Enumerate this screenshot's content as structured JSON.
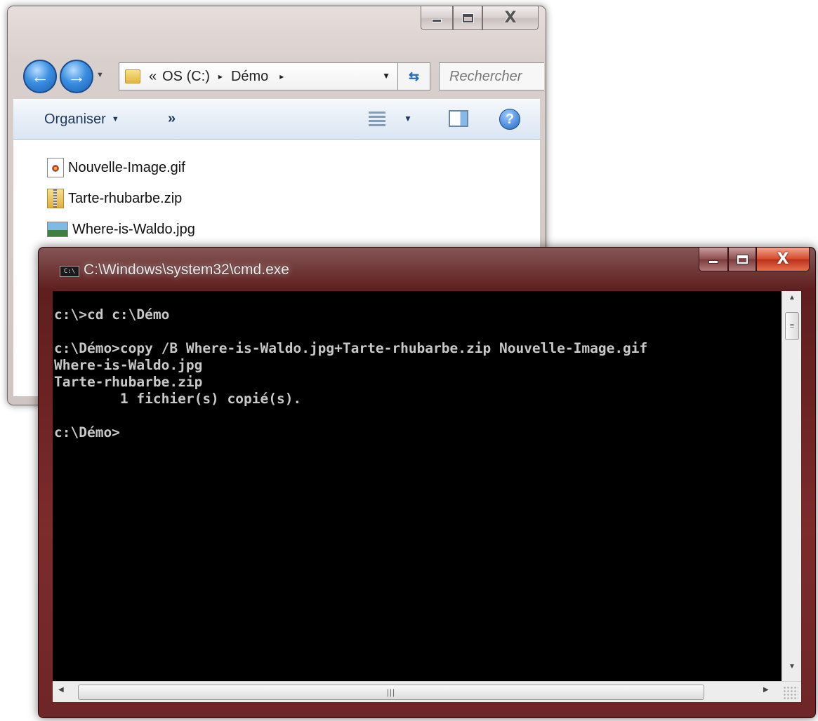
{
  "explorer": {
    "caption": {
      "minimize": "minimize",
      "maximize": "maximize",
      "close": "X"
    },
    "nav": {
      "back_icon": "back-arrow-icon",
      "forward_icon": "forward-arrow-icon"
    },
    "address": {
      "prefix": "«",
      "crumbs": [
        "OS (C:)",
        "Démo"
      ],
      "separator": "▸"
    },
    "search": {
      "placeholder": "Rechercher"
    },
    "toolbar": {
      "organise_label": "Organiser",
      "more": "»"
    },
    "files": [
      {
        "name": "Nouvelle-Image.gif",
        "icon": "gif-file-icon"
      },
      {
        "name": "Tarte-rhubarbe.zip",
        "icon": "zip-file-icon"
      },
      {
        "name": "Where-is-Waldo.jpg",
        "icon": "jpg-file-icon"
      }
    ]
  },
  "cmd": {
    "title": "C:\\Windows\\system32\\cmd.exe",
    "icon_label": "C:\\",
    "lines": [
      "c:\\>cd c:\\Démo",
      "",
      "c:\\Démo>copy /B Where-is-Waldo.jpg+Tarte-rhubarbe.zip Nouvelle-Image.gif",
      "Where-is-Waldo.jpg",
      "Tarte-rhubarbe.zip",
      "        1 fichier(s) copié(s).",
      "",
      "c:\\Démo>"
    ],
    "colors": {
      "background": "#000000",
      "text": "#c8c8c8",
      "frame": "#6a2322"
    }
  }
}
